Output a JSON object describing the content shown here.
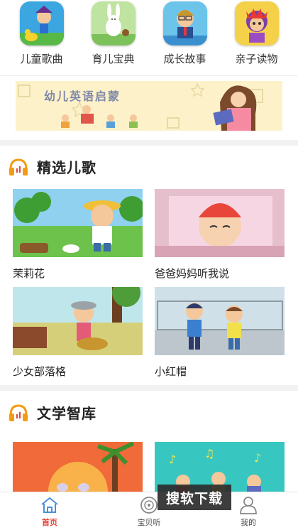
{
  "categories": [
    {
      "label": "儿童歌曲",
      "icon": "kids-songs-icon"
    },
    {
      "label": "育儿宝典",
      "icon": "parenting-icon"
    },
    {
      "label": "成长故事",
      "icon": "growth-story-icon"
    },
    {
      "label": "亲子读物",
      "icon": "parent-child-reading-icon"
    }
  ],
  "banner": {
    "title": "幼儿英语启蒙"
  },
  "sections": [
    {
      "title": "精选儿歌",
      "items": [
        {
          "label": "茉莉花"
        },
        {
          "label": "爸爸妈妈听我说"
        },
        {
          "label": "少女部落格"
        },
        {
          "label": "小红帽"
        }
      ]
    },
    {
      "title": "文学智库",
      "items": []
    }
  ],
  "bottom_nav": [
    {
      "label": "首页",
      "icon": "home-icon",
      "active": true
    },
    {
      "label": "宝贝听",
      "icon": "record-disc-icon",
      "active": false
    },
    {
      "label": "我的",
      "icon": "profile-icon",
      "active": false
    }
  ],
  "watermark": "搜软下载",
  "colors": {
    "accent": "#e4433a",
    "headphone": "#f39c12",
    "banner_bg": "#fdf1c9"
  }
}
